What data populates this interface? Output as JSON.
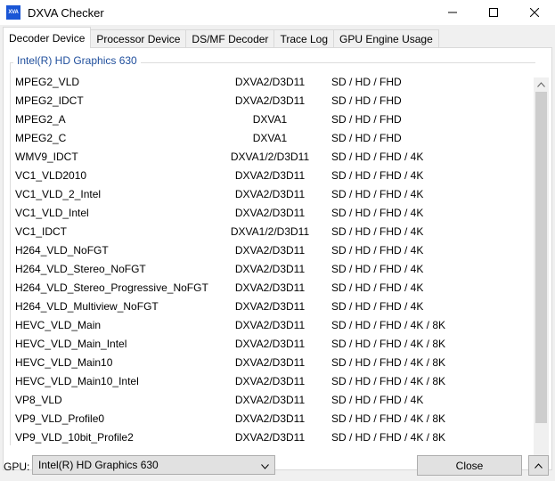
{
  "window": {
    "icon_text": "XVA",
    "title": "DXVA Checker"
  },
  "tabs": [
    {
      "label": "Decoder Device",
      "active": true
    },
    {
      "label": "Processor Device",
      "active": false
    },
    {
      "label": "DS/MF Decoder",
      "active": false
    },
    {
      "label": "Trace Log",
      "active": false
    },
    {
      "label": "GPU Engine Usage",
      "active": false
    }
  ],
  "group": {
    "label": "Intel(R) HD Graphics 630"
  },
  "decoders": [
    {
      "name": "MPEG2_VLD",
      "api": "DXVA2/D3D11",
      "res": "SD / HD / FHD"
    },
    {
      "name": "MPEG2_IDCT",
      "api": "DXVA2/D3D11",
      "res": "SD / HD / FHD"
    },
    {
      "name": "MPEG2_A",
      "api": "DXVA1",
      "res": "SD / HD / FHD"
    },
    {
      "name": "MPEG2_C",
      "api": "DXVA1",
      "res": "SD / HD / FHD"
    },
    {
      "name": "WMV9_IDCT",
      "api": "DXVA1/2/D3D11",
      "res": "SD / HD / FHD / 4K"
    },
    {
      "name": "VC1_VLD2010",
      "api": "DXVA2/D3D11",
      "res": "SD / HD / FHD / 4K"
    },
    {
      "name": "VC1_VLD_2_Intel",
      "api": "DXVA2/D3D11",
      "res": "SD / HD / FHD / 4K"
    },
    {
      "name": "VC1_VLD_Intel",
      "api": "DXVA2/D3D11",
      "res": "SD / HD / FHD / 4K"
    },
    {
      "name": "VC1_IDCT",
      "api": "DXVA1/2/D3D11",
      "res": "SD / HD / FHD / 4K"
    },
    {
      "name": "H264_VLD_NoFGT",
      "api": "DXVA2/D3D11",
      "res": "SD / HD / FHD / 4K"
    },
    {
      "name": "H264_VLD_Stereo_NoFGT",
      "api": "DXVA2/D3D11",
      "res": "SD / HD / FHD / 4K"
    },
    {
      "name": "H264_VLD_Stereo_Progressive_NoFGT",
      "api": "DXVA2/D3D11",
      "res": "SD / HD / FHD / 4K"
    },
    {
      "name": "H264_VLD_Multiview_NoFGT",
      "api": "DXVA2/D3D11",
      "res": "SD / HD / FHD / 4K"
    },
    {
      "name": "HEVC_VLD_Main",
      "api": "DXVA2/D3D11",
      "res": "SD / HD / FHD / 4K / 8K"
    },
    {
      "name": "HEVC_VLD_Main_Intel",
      "api": "DXVA2/D3D11",
      "res": "SD / HD / FHD / 4K / 8K"
    },
    {
      "name": "HEVC_VLD_Main10",
      "api": "DXVA2/D3D11",
      "res": "SD / HD / FHD / 4K / 8K"
    },
    {
      "name": "HEVC_VLD_Main10_Intel",
      "api": "DXVA2/D3D11",
      "res": "SD / HD / FHD / 4K / 8K"
    },
    {
      "name": "VP8_VLD",
      "api": "DXVA2/D3D11",
      "res": "SD / HD / FHD / 4K"
    },
    {
      "name": "VP9_VLD_Profile0",
      "api": "DXVA2/D3D11",
      "res": "SD / HD / FHD / 4K / 8K"
    },
    {
      "name": "VP9_VLD_10bit_Profile2",
      "api": "DXVA2/D3D11",
      "res": "SD / HD / FHD / 4K / 8K"
    }
  ],
  "footer": {
    "gpu_label": "GPU:",
    "gpu_selected": "Intel(R) HD Graphics 630",
    "close_label": "Close"
  },
  "icons": {
    "minimize": "minimize-icon",
    "maximize": "maximize-icon",
    "close": "close-icon",
    "dropdown": "chevron-down-icon",
    "expand": "chevron-up-icon"
  },
  "colors": {
    "group_label": "#1f4e9c",
    "app_icon_bg": "#1a56d6"
  }
}
